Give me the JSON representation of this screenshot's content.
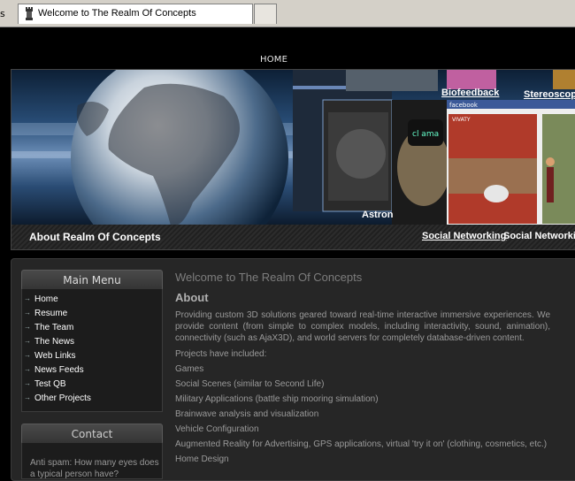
{
  "browser": {
    "tab_left_stub": "s",
    "tab_title": "Welcome to The Realm Of Concepts"
  },
  "nav": {
    "home": "HOME"
  },
  "banner": {
    "links": [
      "Biofeedback",
      "Stereoscopi",
      "Social Networking"
    ],
    "labels": [
      "Astron",
      "Social Networkin"
    ],
    "thumb_text": {
      "facebook": "facebook",
      "vivaty": "VIVATY",
      "cl_ama": "cl ama"
    }
  },
  "about_bar": {
    "title": "About Realm Of Concepts"
  },
  "sidebar": {
    "menu_title": "Main Menu",
    "items": [
      "Home",
      "Resume",
      "The Team",
      "The News",
      "Web Links",
      "News Feeds",
      "Test QB",
      "Other Projects"
    ],
    "contact_title": "Contact",
    "antispam": "Anti spam: How many eyes does a typical person have?"
  },
  "main": {
    "title": "Welcome to The Realm Of Concepts",
    "section": "About",
    "intro": "Providing custom 3D solutions geared toward real-time interactive immersive experiences. We provide content (from simple to complex models, including interactivity, sound, animation), connectivity (such as AjaX3D), and world servers for completely database-driven content.",
    "projects_label": "Projects have included:",
    "projects": [
      "Games",
      "Social Scenes (similar to Second Life)",
      "Military Applications (battle ship mooring simulation)",
      "Brainwave analysis and visualization",
      "Vehicle Configuration",
      "Augmented Reality for Advertising, GPS applications, virtual 'try it on' (clothing, cosmetics, etc.)",
      "Home Design"
    ]
  }
}
